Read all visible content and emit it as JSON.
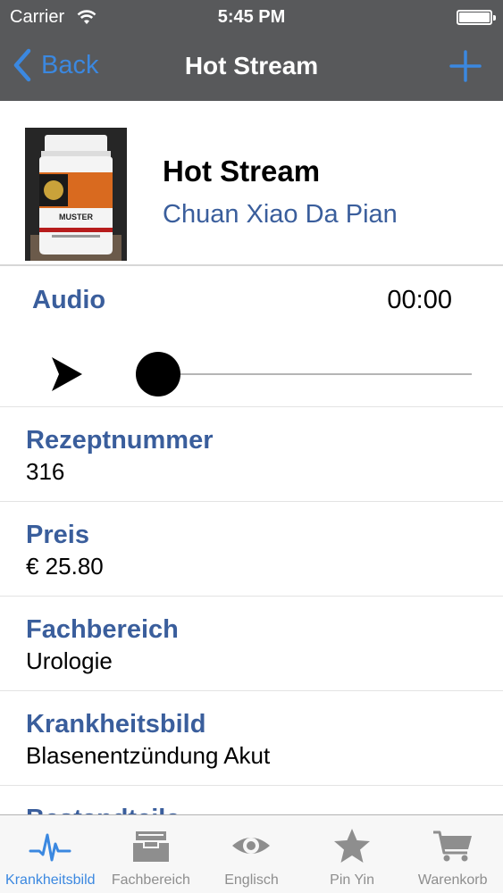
{
  "status_bar": {
    "carrier": "Carrier",
    "time": "5:45 PM"
  },
  "nav": {
    "back_label": "Back",
    "title": "Hot Stream"
  },
  "product": {
    "name": "Hot Stream",
    "subname": "Chuan Xiao Da Pian",
    "image_label": "MUSTER"
  },
  "audio": {
    "label": "Audio",
    "time": "00:00",
    "progress": 0
  },
  "details": [
    {
      "key": "Rezeptnummer",
      "value": "316"
    },
    {
      "key": "Preis",
      "value": "€ 25.80"
    },
    {
      "key": "Fachbereich",
      "value": "Urologie"
    },
    {
      "key": "Krankheitsbild",
      "value": "Blasenentzündung Akut"
    },
    {
      "key": "Bestandteile",
      "value": ""
    }
  ],
  "tabs": [
    {
      "label": "Krankheitsbild",
      "icon": "pulse-icon",
      "active": true
    },
    {
      "label": "Fachbereich",
      "icon": "inbox-tray-icon",
      "active": false
    },
    {
      "label": "Englisch",
      "icon": "eye-icon",
      "active": false
    },
    {
      "label": "Pin Yin",
      "icon": "star-icon",
      "active": false
    },
    {
      "label": "Warenkorb",
      "icon": "shopping-cart-icon",
      "active": false
    }
  ],
  "colors": {
    "bar_background": "#58595b",
    "accent": "#3b88e0",
    "heading_blue": "#3a5e9c",
    "tab_inactive": "#8e8e8e"
  }
}
